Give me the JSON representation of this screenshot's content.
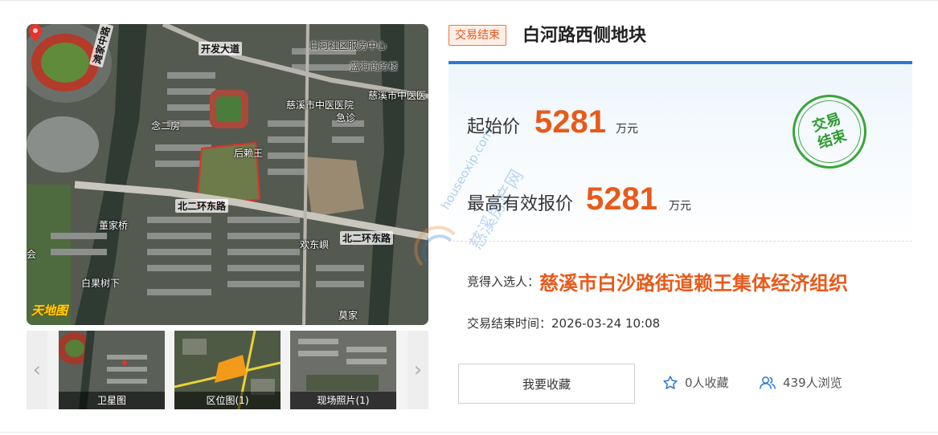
{
  "map": {
    "labels": {
      "kaifa": "开发大道",
      "community": "白河社区服务中心",
      "business": "蓝海商务楼",
      "hospital": "慈溪市中医医院",
      "hospital_short": "慈溪市中医医",
      "emergency": "急诊",
      "nianer": "念二房",
      "houlaiwang": "后赖王",
      "beier_west": "北二环东路",
      "beier_east": "北二环东路",
      "dongjia": "董家桥",
      "baiguo": "白果树下",
      "huandong": "欢东嶼",
      "mojia": "莫家",
      "tanjia": "滩家中路",
      "hui": "会"
    },
    "logo": "天地图"
  },
  "thumbs": [
    {
      "caption": "卫星图"
    },
    {
      "caption": "区位图(1)"
    },
    {
      "caption": "现场照片(1)"
    }
  ],
  "nav": {
    "prev": "‹",
    "next": "›"
  },
  "status_tag": "交易结束",
  "title": "白河路西侧地块",
  "prices": {
    "start_label": "起始价",
    "start_value": "5281",
    "start_unit": "万元",
    "high_label": "最高有效报价",
    "high_value": "5281",
    "high_unit": "万元"
  },
  "stamp": {
    "line1": "交易",
    "line2": "结束"
  },
  "watermark": {
    "line1": "houseoxip.com",
    "line2": "慈溪房产网"
  },
  "winner": {
    "label": "竞得入选人：",
    "value": "慈溪市白沙路街道赖王集体经济组织"
  },
  "end_time": {
    "label": "交易结束时间：",
    "value": "2026-03-24 10:08"
  },
  "actions": {
    "favorite_button": "我要收藏",
    "favorites_count": "0人收藏",
    "views_count": "439人浏览"
  },
  "colors": {
    "accent": "#2c78d4",
    "price": "#e85a1a",
    "stamp": "#3aa53a",
    "tag_border": "#f0733a"
  },
  "icons": {
    "favorites": "star-icon",
    "views": "users-icon"
  }
}
